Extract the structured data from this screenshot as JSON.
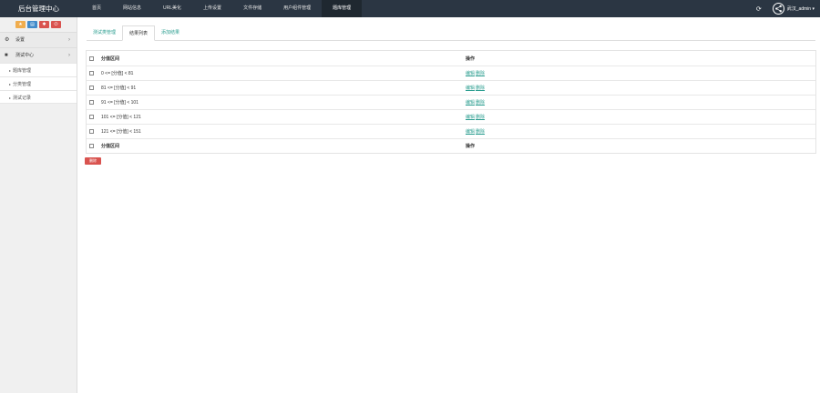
{
  "app": {
    "title": "后台管理中心"
  },
  "nav": {
    "items": [
      "首页",
      "网站信息",
      "URL美化",
      "上传设置",
      "文件存储",
      "用户组件管理",
      "题库管理"
    ],
    "active_index": 6
  },
  "header": {
    "refresh_icon": "refresh-icon",
    "user_label": "武汉_admin"
  },
  "sidebar": {
    "quick_buttons": [
      {
        "icon": "star-icon",
        "glyph": "★",
        "color": "#f0ad4e"
      },
      {
        "icon": "file-icon",
        "glyph": "▤",
        "color": "#428bca"
      },
      {
        "icon": "gear-icon",
        "glyph": "✱",
        "color": "#d9534f"
      },
      {
        "icon": "power-icon",
        "glyph": "⏻",
        "color": "#d9534f"
      }
    ],
    "groups": [
      {
        "label": "设置"
      },
      {
        "label": "测试中心"
      }
    ],
    "sub_items": [
      "题库管理",
      "分类管理",
      "测试记录"
    ]
  },
  "tabs": [
    "测试类管理",
    "结果列表",
    "添加结果"
  ],
  "active_tab": 1,
  "table": {
    "header": {
      "range": "分值区间",
      "op": "操作"
    },
    "rows": [
      {
        "range": "0 <= [分值] < 81",
        "edit": "编辑",
        "del": "删除"
      },
      {
        "range": "81 <= [分值] < 91",
        "edit": "编辑",
        "del": "删除"
      },
      {
        "range": "91 <= [分值] < 101",
        "edit": "编辑",
        "del": "删除"
      },
      {
        "range": "101 <= [分值] < 121",
        "edit": "编辑",
        "del": "删除"
      },
      {
        "range": "121 <= [分值] < 151",
        "edit": "编辑",
        "del": "删除"
      }
    ],
    "footer": {
      "range": "分值区间",
      "op": "操作"
    }
  },
  "actions": {
    "delete_label": "删除"
  }
}
